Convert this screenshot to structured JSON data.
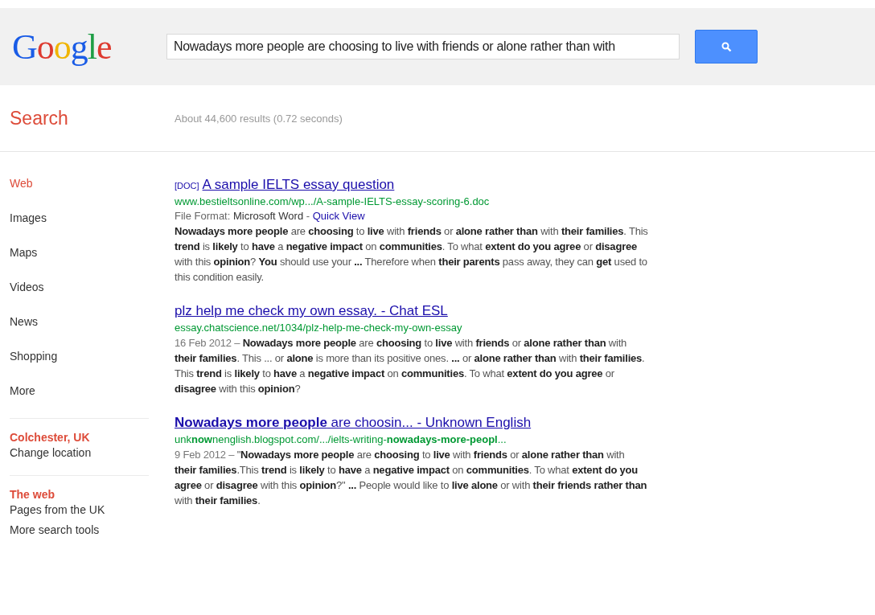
{
  "header": {
    "logo": "Google",
    "search": {
      "value": "Nowadays more people are choosing to live with friends or alone rather than with"
    }
  },
  "page_title": "Search",
  "result_stats": "About 44,600 results (0.72 seconds)",
  "sidebar": {
    "items": [
      {
        "label": "Web",
        "selected": true
      },
      {
        "label": "Images",
        "selected": false
      },
      {
        "label": "Maps",
        "selected": false
      },
      {
        "label": "Videos",
        "selected": false
      },
      {
        "label": "News",
        "selected": false
      },
      {
        "label": "Shopping",
        "selected": false
      },
      {
        "label": "More",
        "selected": false
      }
    ],
    "sections": [
      {
        "heading": "Colchester, UK",
        "links": [
          "Change location"
        ]
      },
      {
        "heading": "The web",
        "links": [
          "Pages from the UK",
          "More search tools"
        ]
      }
    ]
  },
  "results": [
    {
      "tag": "[DOC]",
      "title": "A sample IELTS essay question",
      "url": "www.bestieltsonline.com/wp.../A-sample-IELTS-essay-scoring-6.doc",
      "file_format": {
        "label": "File Format:",
        "value": "Microsoft Word",
        "separator": "-",
        "link": "Quick View"
      },
      "snippet": "**Nowadays more people** are **choosing** to **live** with **friends** or **alone rather than** with **their families**. This **trend** is **likely** to **have** a **negative impact** on **communities**. To what **extent do you agree** or **disagree** with this **opinion**? **You** should use your **...** Therefore when **their parents** pass away, they can **get** used to this condition easily."
    },
    {
      "title": "plz help me check my own essay. - Chat ESL",
      "url": "essay.chatscience.net/1034/plz-help-me-check-my-own-essay",
      "date": "16 Feb 2012 –",
      "snippet": "**Nowadays more people** are **choosing** to **live** with **friends** or **alone rather than** with **their families**. This ... or **alone** is more than its positive ones. **...** or **alone rather than** with **their families**. This **trend** is **likely** to **have** a **negative impact** on **communities**. To what **extent do you agree** or **disagree** with this **opinion**?"
    },
    {
      "title": "**Nowadays more people** are choosin... - Unknown English",
      "url": "unk**now**nenglish.blogspot.com/.../ielts-writing-**nowadays-more-peopl**...",
      "date": "9 Feb 2012 –",
      "snippet": "\"**Nowadays more people** are **choosing** to **live** with **friends** or **alone rather than** with **their families**.This **trend** is **likely** to **have** a **negative impact** on **communities**. To what **extent do you agree** or **disagree** with this **opinion**?\" **...** People would like to **live alone** or with **their friends rather than** with **their families**."
    }
  ]
}
